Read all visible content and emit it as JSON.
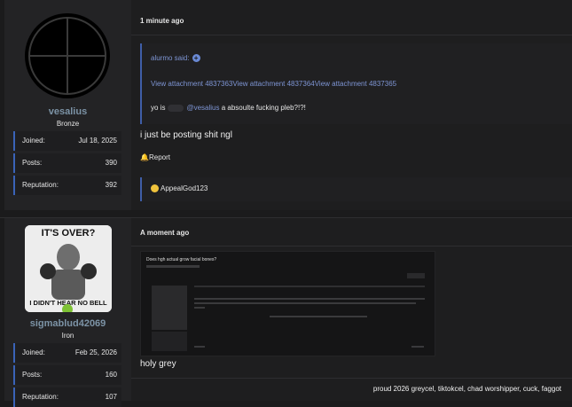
{
  "posts": [
    {
      "author": {
        "username": "vesalius",
        "rank": "Bronze",
        "joined_label": "Joined:",
        "joined": "Jul 18, 2025",
        "posts_label": "Posts:",
        "posts": "390",
        "reputation_label": "Reputation:",
        "reputation": "392"
      },
      "time": "1 minute ago",
      "quote": {
        "author": "alurmo said:",
        "attachments": "View attachment 4837363View attachment 4837364View attachment 4837365",
        "text_prefix": "yo is",
        "mention": "@vesalius",
        "text_suffix": "a absoulte fucking pleb?!?!"
      },
      "body": "i just be posting shit ngl",
      "report": "Report",
      "reaction_user": "AppealGod123"
    },
    {
      "author": {
        "username": "sigmablud42069",
        "rank": "Iron",
        "joined_label": "Joined:",
        "joined": "Feb 25, 2026",
        "posts_label": "Posts:",
        "posts": "160",
        "reputation_label": "Reputation:",
        "reputation": "107"
      },
      "time": "A moment ago",
      "embedded_screenshot": {
        "title": "Does hgh actual grow facial bones?"
      },
      "avatar_text": {
        "top": "IT'S OVER?",
        "bottom": "I DIDN'T HEAR NO BELL"
      },
      "body": "holy grey",
      "signature": "proud 2026 greycel, tiktokcel, chad worshipper, cuck, faggot"
    }
  ],
  "colors": {
    "accent": "#3a63b8",
    "link": "#7e95d4",
    "username": "#7c93a6",
    "online": "#7ec234"
  }
}
